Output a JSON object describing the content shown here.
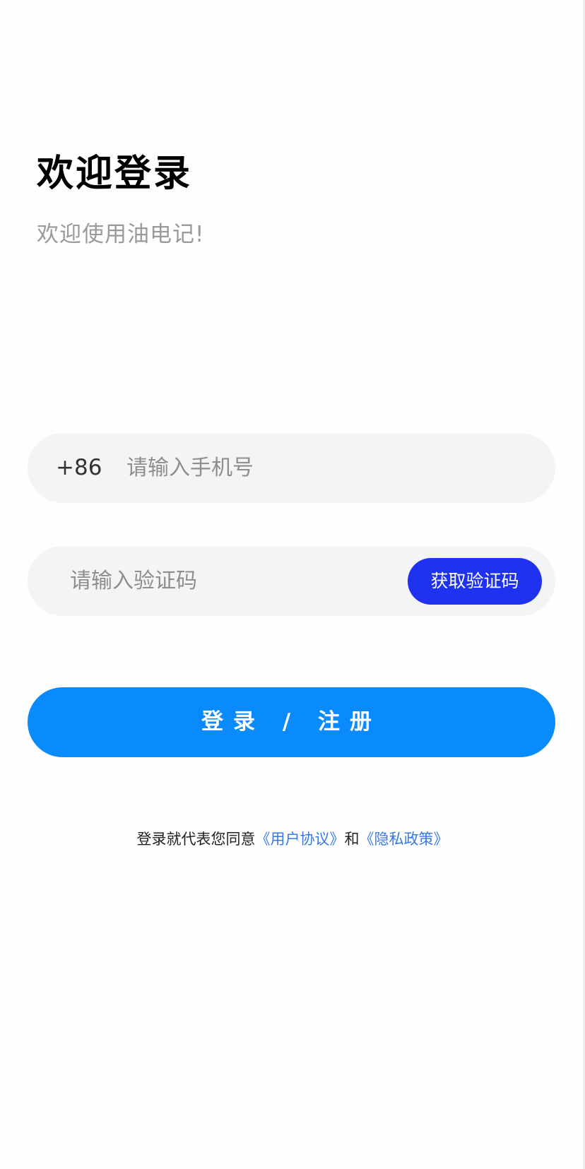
{
  "header": {
    "title": "欢迎登录",
    "subtitle": "欢迎使用油电记!"
  },
  "phone": {
    "country_code": "+86",
    "placeholder": "请输入手机号",
    "value": ""
  },
  "code": {
    "placeholder": "请输入验证码",
    "value": "",
    "get_code_label": "获取验证码"
  },
  "login": {
    "label": "登录 / 注册"
  },
  "agreement": {
    "prefix": "登录就代表您同意",
    "user_agreement": "《用户协议》",
    "conjunction": "和",
    "privacy_policy": "《隐私政策》"
  },
  "colors": {
    "primary": "#0a8bfc",
    "code_button": "#1f32f0",
    "link": "#3a78e6",
    "field_bg": "#f3f4f6"
  }
}
